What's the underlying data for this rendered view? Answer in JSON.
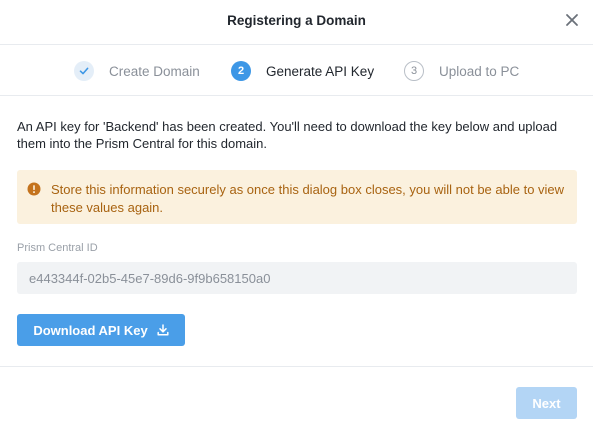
{
  "dialog": {
    "title": "Registering a Domain",
    "close_icon": "close-icon"
  },
  "steps": [
    {
      "number": "1",
      "label": "Create Domain",
      "state": "done",
      "icon": "check-icon"
    },
    {
      "number": "2",
      "label": "Generate API Key",
      "state": "active"
    },
    {
      "number": "3",
      "label": "Upload to PC",
      "state": "todo"
    }
  ],
  "body": {
    "description": "An API key for 'Backend' has been created. You'll need to download the key below and upload them into the Prism Central for this domain.",
    "warning": {
      "icon": "warning-icon",
      "text": "Store this information securely as once this dialog box closes, you will not be able to view these values again."
    },
    "prism_central_id": {
      "label": "Prism Central ID",
      "value": "e443344f-02b5-45e7-89d6-9f9b658150a0"
    },
    "download_button": {
      "label": "Download API Key",
      "icon": "download-icon"
    }
  },
  "footer": {
    "next_label": "Next",
    "next_enabled": false
  },
  "colors": {
    "accent": "#3d97e6",
    "button": "#4a9ee8",
    "button_disabled": "#b3d5f5",
    "warning_bg": "#fbf1de",
    "warning_text": "#a86311"
  }
}
